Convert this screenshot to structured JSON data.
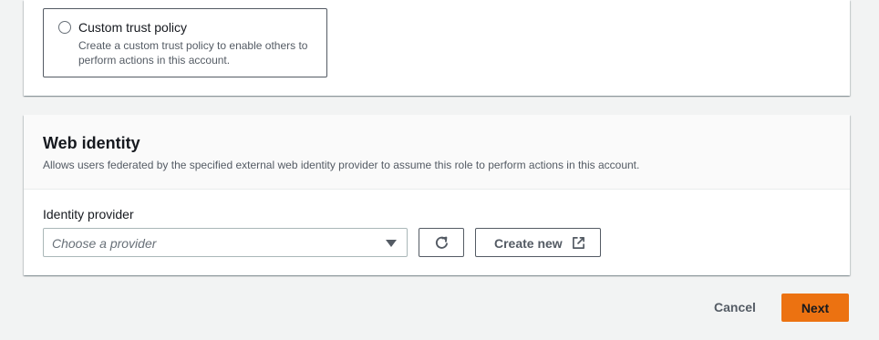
{
  "trust_tile": {
    "title": "Custom trust policy",
    "description": "Create a custom trust policy to enable others to perform actions in this account."
  },
  "web_identity": {
    "title": "Web identity",
    "description": "Allows users federated by the specified external web identity provider to assume this role to perform actions in this account.",
    "field_label": "Identity provider",
    "select_placeholder": "Choose a provider",
    "refresh_icon": "refresh-icon",
    "create_new_label": "Create new",
    "external_icon": "external-link-icon"
  },
  "footer": {
    "cancel_label": "Cancel",
    "next_label": "Next"
  },
  "colors": {
    "primary": "#ec7211",
    "page_bg": "#f2f3f3"
  }
}
